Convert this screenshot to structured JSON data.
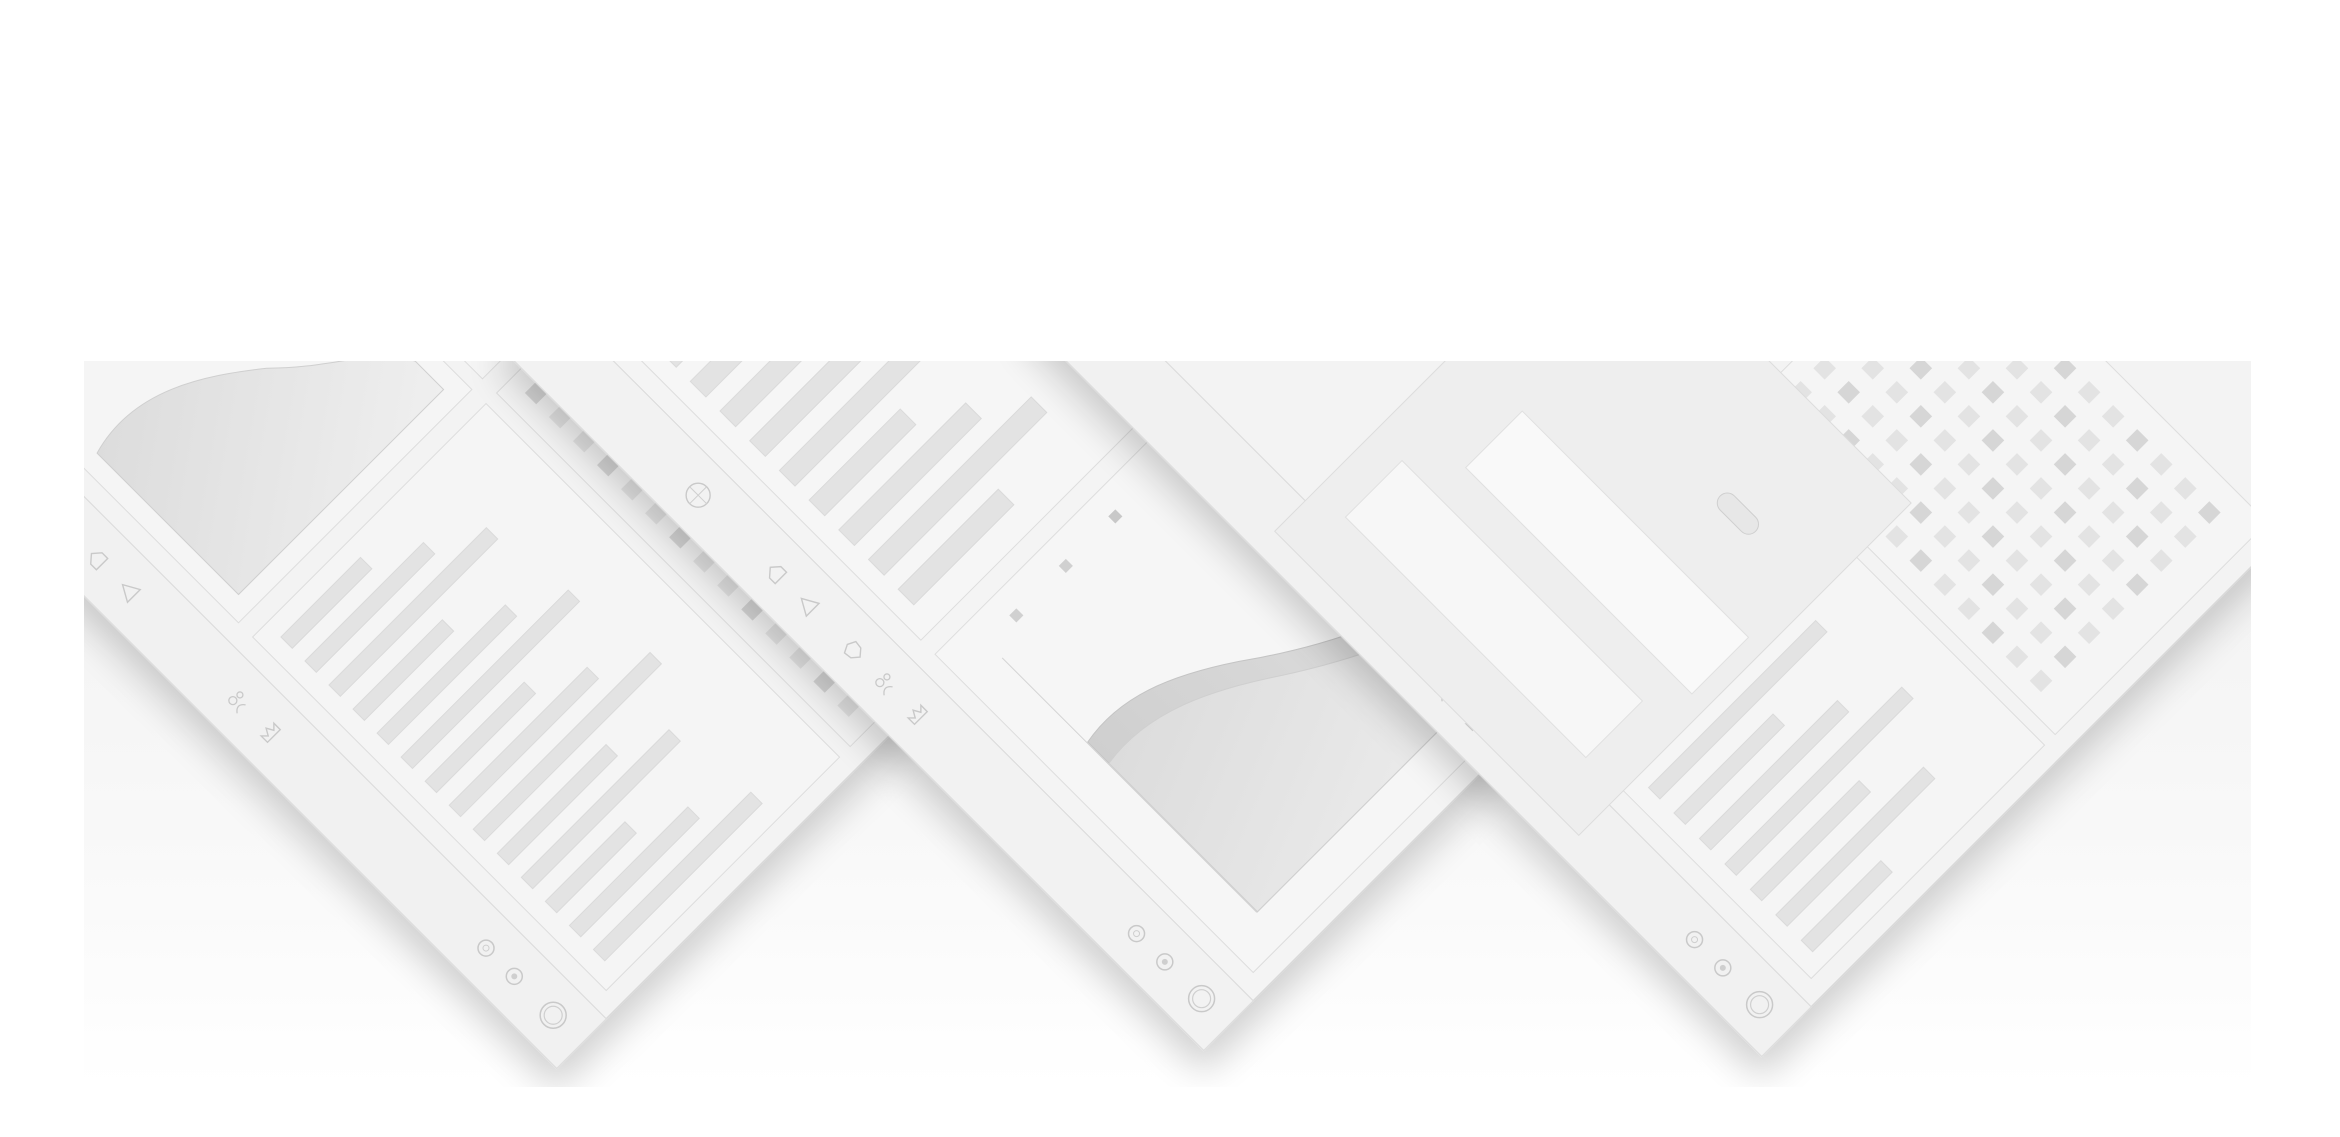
{
  "scene": {
    "background_color": "#ffffff",
    "band_color": "#f2f2f2",
    "panel_color": "#f3f3f3",
    "stroke_color": "#d8d8d8",
    "placeholder_color": "#e3e3e3",
    "placeholder_dark": "#d6d6d6",
    "chart_fill_light": "#e9e9e9",
    "chart_fill_dark": "#d2d2d2"
  },
  "mockups": [
    {
      "id": "mockup-left",
      "variant": "bars-and-grid",
      "sidebar_icons": [
        "globe-icon",
        "home-icon",
        "alert-icon",
        "people-icon",
        "crown-icon"
      ],
      "footer_icons": [
        "record-icon",
        "settings-icon",
        "profile-icon"
      ]
    },
    {
      "id": "mockup-center",
      "variant": "area-chart",
      "sidebar_icons": [
        "globe-icon",
        "home-icon",
        "alert-icon",
        "shield-icon",
        "people-icon",
        "crown-icon"
      ],
      "footer_icons": [
        "record-icon",
        "settings-icon",
        "profile-icon"
      ]
    },
    {
      "id": "mockup-right",
      "variant": "form-and-grid",
      "sidebar_icons": [
        "people-icon",
        "crown-icon"
      ],
      "footer_icons": [
        "record-icon",
        "settings-icon",
        "profile-icon"
      ]
    }
  ]
}
